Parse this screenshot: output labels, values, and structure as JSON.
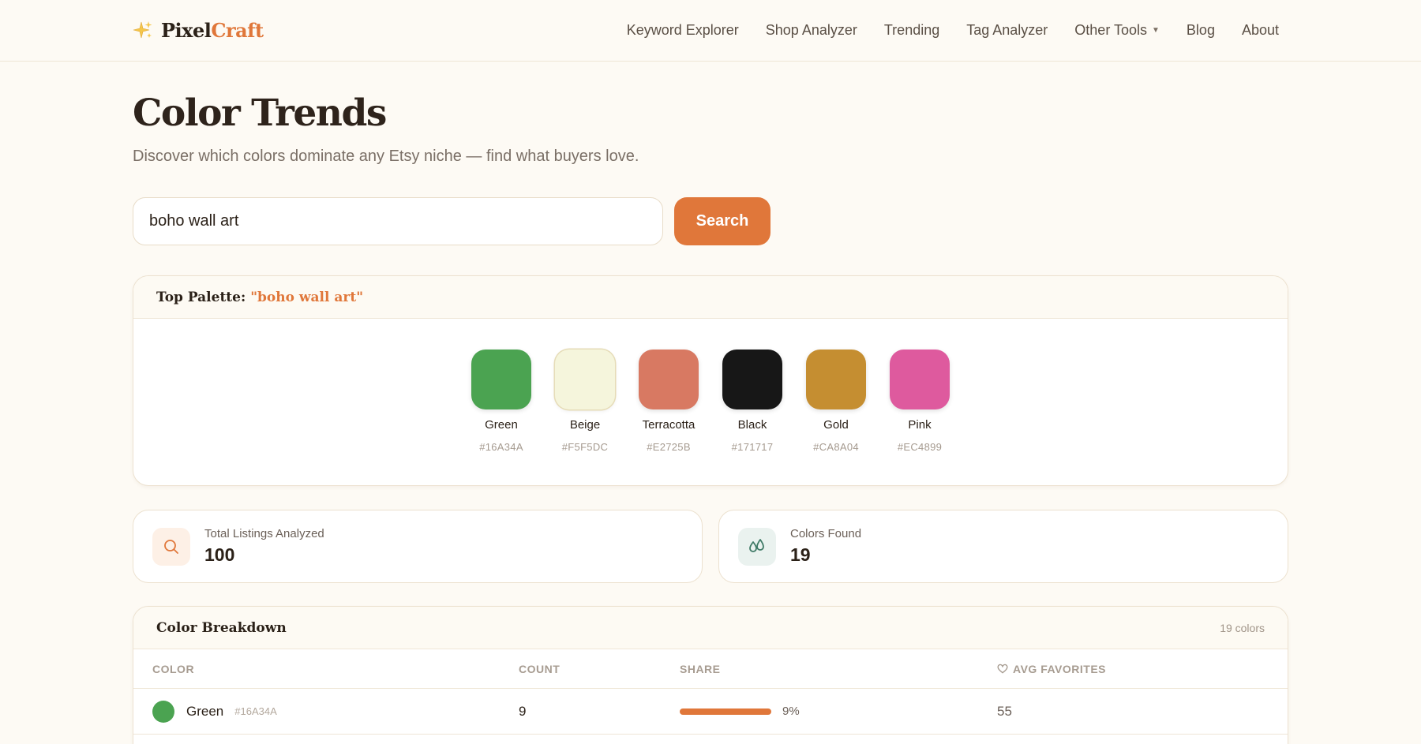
{
  "brand": {
    "part1": "Pixel",
    "part2": "Craft",
    "icon": "sparkles-icon"
  },
  "nav": {
    "items": [
      "Keyword Explorer",
      "Shop Analyzer",
      "Trending",
      "Tag Analyzer"
    ],
    "other_tools": "Other Tools",
    "blog": "Blog",
    "about": "About"
  },
  "page": {
    "title": "Color Trends",
    "subtitle": "Discover which colors dominate any Etsy niche — find what buyers love."
  },
  "search": {
    "value": "boho wall art",
    "button": "Search"
  },
  "palette": {
    "label": "Top Palette:",
    "query": "\"boho wall art\"",
    "swatches": [
      {
        "name": "Green",
        "hex": "#16A34A",
        "color": "#4BA351"
      },
      {
        "name": "Beige",
        "hex": "#F5F5DC",
        "color": "#F5F5DC"
      },
      {
        "name": "Terracotta",
        "hex": "#E2725B",
        "color": "#D87962"
      },
      {
        "name": "Black",
        "hex": "#171717",
        "color": "#171717"
      },
      {
        "name": "Gold",
        "hex": "#CA8A04",
        "color": "#C58E31"
      },
      {
        "name": "Pink",
        "hex": "#EC4899",
        "color": "#DE5A9E"
      }
    ]
  },
  "stats": {
    "listings": {
      "label": "Total Listings Analyzed",
      "value": "100",
      "icon": "search-icon",
      "accent": "#e0773a"
    },
    "colors": {
      "label": "Colors Found",
      "value": "19",
      "icon": "droplets-icon",
      "accent": "#3f7a66"
    }
  },
  "breakdown": {
    "title": "Color Breakdown",
    "count_note": "19 colors",
    "headers": {
      "color": "COLOR",
      "count": "COUNT",
      "share": "SHARE",
      "fav": "AVG FAVORITES"
    },
    "rows": [
      {
        "name": "Green",
        "hex": "#16A34A",
        "color": "#4BA351",
        "count": "9",
        "share": "9%",
        "share_value": 9,
        "fav": "55"
      }
    ]
  }
}
